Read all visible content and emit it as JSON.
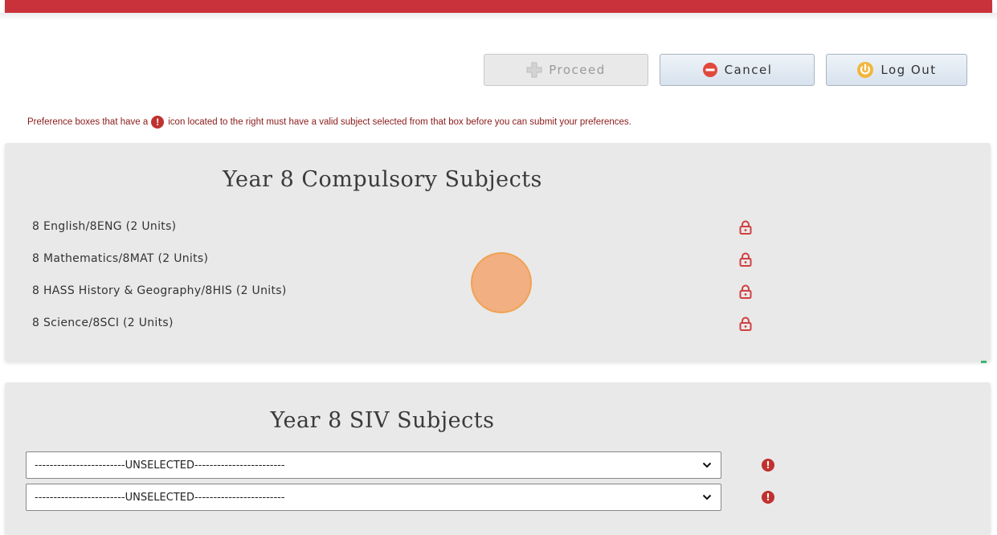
{
  "toolbar": {
    "proceed_label": "Proceed",
    "cancel_label": "Cancel",
    "logout_label": "Log Out"
  },
  "notice": {
    "prefix": "Preference boxes that have a",
    "icon": "alert-icon",
    "suffix": "icon located to the right must have a valid subject selected from that box before you can submit your preferences."
  },
  "compulsory": {
    "title": "Year 8 Compulsory Subjects",
    "subjects": [
      "8 English/8ENG (2 Units)",
      "8 Mathematics/8MAT (2 Units)",
      "8 HASS History & Geography/8HIS (2 Units)",
      "8 Science/8SCI (2 Units)"
    ]
  },
  "siv": {
    "title": "Year 8 SIV Subjects",
    "selects": [
      "------------------------UNSELECTED------------------------",
      "------------------------UNSELECTED------------------------"
    ]
  },
  "colors": {
    "brand_red": "#c9323a",
    "notice_text": "#8b1a1a",
    "required_icon": "#c0312f"
  }
}
